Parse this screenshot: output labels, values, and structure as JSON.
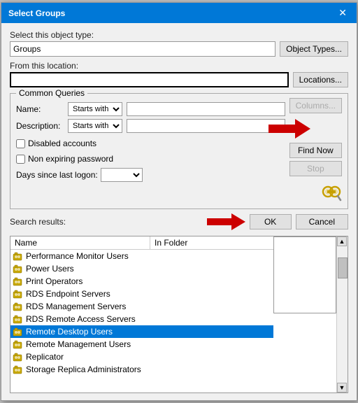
{
  "dialog": {
    "title": "Select Groups",
    "close_icon": "✕"
  },
  "object_type": {
    "label": "Select this object type:",
    "value": "Groups",
    "button": "Object Types..."
  },
  "location": {
    "label": "From this location:",
    "value": "",
    "button": "Locations..."
  },
  "common_queries": {
    "legend": "Common Queries",
    "name_label": "Name:",
    "name_starts_with": "Starts with",
    "description_label": "Description:",
    "description_starts_with": "Starts with",
    "columns_btn": "Columns...",
    "find_now_btn": "Find Now",
    "stop_btn": "Stop",
    "disabled_accounts": "Disabled accounts",
    "non_expiring_password": "Non expiring password",
    "days_since_label": "Days since last logon:"
  },
  "search_results": {
    "label": "Search results:",
    "ok_btn": "OK",
    "cancel_btn": "Cancel",
    "column_name": "Name",
    "column_folder": "In Folder",
    "items": [
      {
        "name": "Performance Monitor Users",
        "folder": "",
        "selected": false
      },
      {
        "name": "Power Users",
        "folder": "",
        "selected": false
      },
      {
        "name": "Print Operators",
        "folder": "",
        "selected": false
      },
      {
        "name": "RDS Endpoint Servers",
        "folder": "",
        "selected": false
      },
      {
        "name": "RDS Management Servers",
        "folder": "",
        "selected": false
      },
      {
        "name": "RDS Remote Access Servers",
        "folder": "",
        "selected": false
      },
      {
        "name": "Remote Desktop Users",
        "folder": "",
        "selected": true
      },
      {
        "name": "Remote Management Users",
        "folder": "",
        "selected": false
      },
      {
        "name": "Replicator",
        "folder": "",
        "selected": false
      },
      {
        "name": "Storage Replica Administrators",
        "folder": "",
        "selected": false
      }
    ]
  }
}
